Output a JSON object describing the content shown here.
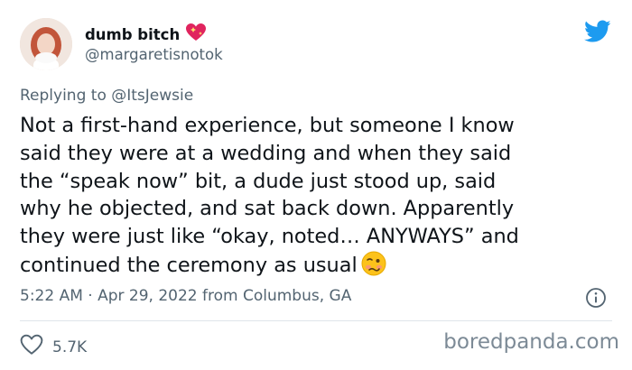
{
  "user": {
    "display_name": "dumb bitch",
    "handle": "@margaretisnotok"
  },
  "reply": {
    "prefix": "Replying to",
    "target": "@ItsJewsie"
  },
  "tweet": {
    "lines": [
      "Not a first-hand experience, but someone I know",
      "said they were at a wedding and when they said",
      "the “speak now” bit, a dude just stood up, said",
      "why he objected, and sat back down. Apparently",
      "they were just like “okay, noted… ANYWAYS” and",
      "continued the ceremony as usual"
    ],
    "emoji": "woozy-face"
  },
  "meta": {
    "timestamp": "5:22 AM · Apr 29, 2022 from Columbus, GA"
  },
  "stats": {
    "likes": "5.7K"
  },
  "watermark": "boredpanda.com",
  "icons": {
    "verified_heart": "sparkling-heart-icon",
    "bird": "twitter-bird-icon",
    "info": "info-icon",
    "like": "heart-outline-icon"
  },
  "colors": {
    "twitter_blue": "#1d9bf0",
    "text": "#0f1419",
    "secondary": "#536471",
    "heart": "#e0245e"
  }
}
